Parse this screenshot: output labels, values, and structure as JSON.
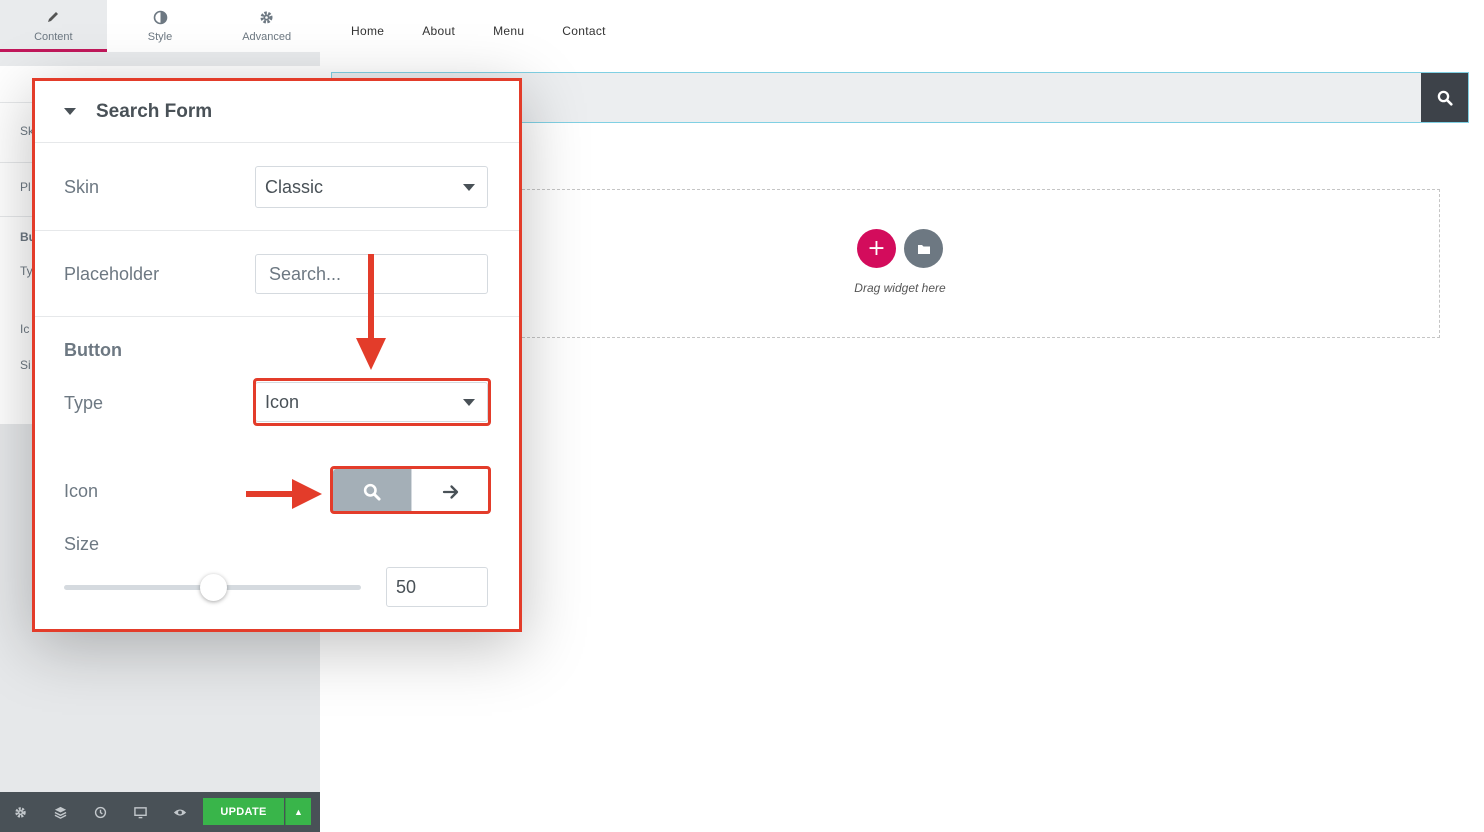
{
  "editor": {
    "tabs": [
      {
        "label": "Content",
        "icon": "pencil-icon"
      },
      {
        "label": "Style",
        "icon": "half-circle-icon"
      },
      {
        "label": "Advanced",
        "icon": "gear-icon"
      }
    ],
    "partial_labels": [
      "Sk",
      "Pl",
      "Bu",
      "Ty",
      "Ic",
      "Si"
    ],
    "bottom_bar": {
      "icons": [
        "settings-icon",
        "layers-icon",
        "history-icon",
        "responsive-icon",
        "preview-eye-icon"
      ],
      "update_label": "UPDATE"
    }
  },
  "popup": {
    "section_title": "Search Form",
    "skin": {
      "label": "Skin",
      "value": "Classic"
    },
    "placeholder": {
      "label": "Placeholder",
      "value": "Search..."
    },
    "button_heading": "Button",
    "type": {
      "label": "Type",
      "value": "Icon"
    },
    "icon": {
      "label": "Icon",
      "options": [
        "search-icon",
        "arrow-right-icon"
      ],
      "selected": "search-icon"
    },
    "size": {
      "label": "Size",
      "value": "50",
      "slider_fraction": 0.5
    }
  },
  "preview": {
    "nav": [
      "Home",
      "About",
      "Menu",
      "Contact"
    ],
    "drag_text": "Drag widget here"
  },
  "colors": {
    "accent": "#d30c5c",
    "highlight": "#e33c2a",
    "update_green": "#39b54a",
    "panel_dark": "#495157"
  }
}
